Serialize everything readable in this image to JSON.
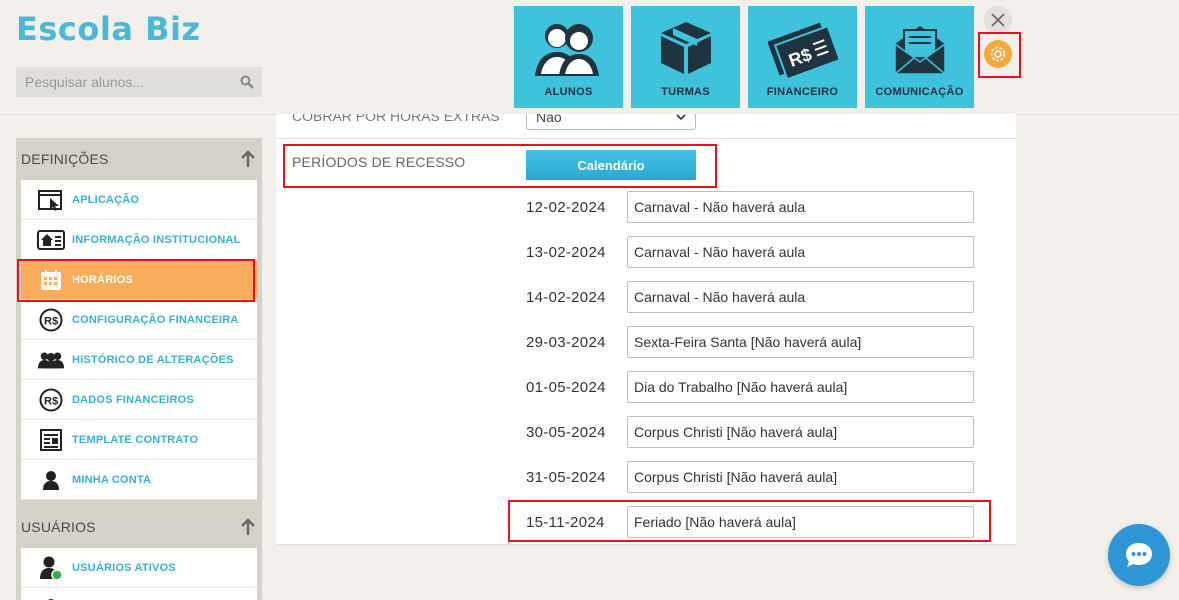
{
  "app": {
    "title": "Escola Biz"
  },
  "search": {
    "placeholder": "Pesquisar alunos..."
  },
  "nav": [
    {
      "label": "ALUNOS",
      "icon": "students-icon"
    },
    {
      "label": "TURMAS",
      "icon": "box-icon"
    },
    {
      "label": "FINANCEIRO",
      "icon": "money-icon"
    },
    {
      "label": "COMUNICAÇÃO",
      "icon": "mail-icon"
    }
  ],
  "sidebar": {
    "definicoes": {
      "title": "DEFINIÇÕES",
      "items": [
        {
          "label": "APLICAÇÃO",
          "icon": "cursor-window-icon"
        },
        {
          "label": "INFORMAÇÃO INSTITUCIONAL",
          "icon": "institution-card-icon"
        },
        {
          "label": "HORÁRIOS",
          "icon": "calendar-icon",
          "active": true
        },
        {
          "label": "CONFIGURAÇÃO FINANCEIRA",
          "icon": "currency-icon"
        },
        {
          "label": "HISTÓRICO DE ALTERAÇÕES",
          "icon": "group-icon"
        },
        {
          "label": "DADOS FINANCEIROS",
          "icon": "currency-icon"
        },
        {
          "label": "TEMPLATE CONTRATO",
          "icon": "document-icon"
        },
        {
          "label": "MINHA CONTA",
          "icon": "user-icon"
        }
      ]
    },
    "usuarios": {
      "title": "USUÁRIOS",
      "items": [
        {
          "label": "USUÁRIOS ATIVOS",
          "icon": "user-active-icon"
        }
      ]
    }
  },
  "content": {
    "prev_field": {
      "label": "COBRAR POR HORAS EXTRAS",
      "value": "Não"
    },
    "recess": {
      "label": "PERÍODOS DE RECESSO",
      "button": "Calendário",
      "rows": [
        {
          "date": "12-02-2024",
          "desc": "Carnaval - Não haverá aula"
        },
        {
          "date": "13-02-2024",
          "desc": "Carnaval - Não haverá aula"
        },
        {
          "date": "14-02-2024",
          "desc": "Carnaval - Não haverá aula"
        },
        {
          "date": "29-03-2024",
          "desc": "Sexta-Feira Santa [Não haverá aula]"
        },
        {
          "date": "01-05-2024",
          "desc": "Dia do Trabalho [Não haverá aula]"
        },
        {
          "date": "30-05-2024",
          "desc": "Corpus Christi [Não haverá aula]"
        },
        {
          "date": "31-05-2024",
          "desc": "Corpus Christi [Não haverá aula]"
        },
        {
          "date": "15-11-2024",
          "desc": "Feriado [Não haverá aula]"
        }
      ]
    }
  },
  "colors": {
    "accent": "#3fc3dd",
    "active": "#f9ad5c",
    "highlight": "#e3141b",
    "logo": "#4cb8d6"
  }
}
